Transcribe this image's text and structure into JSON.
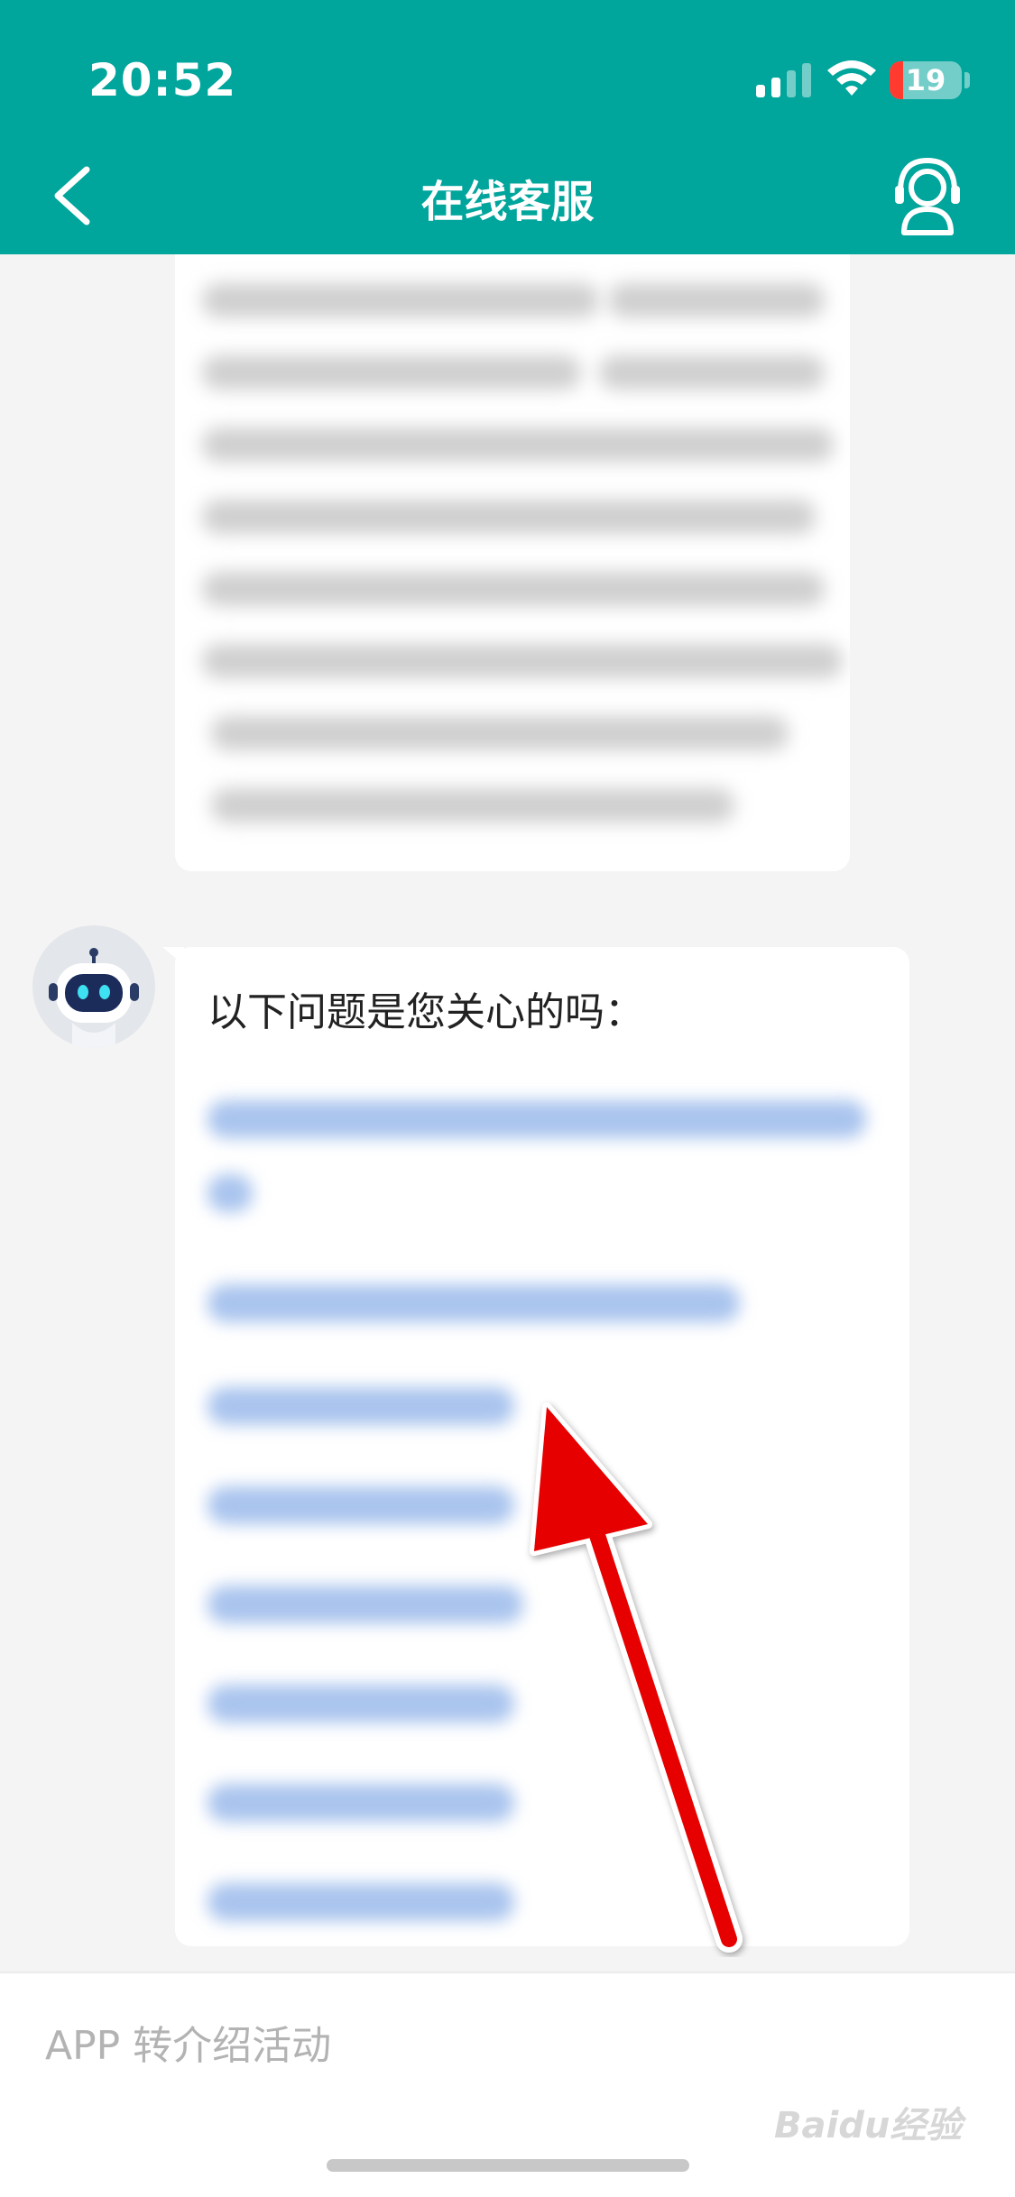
{
  "status_bar": {
    "time": "20:52",
    "battery_level": "19"
  },
  "header": {
    "title": "在线客服"
  },
  "messages": {
    "question_prompt": "以下问题是您关心的吗："
  },
  "input": {
    "placeholder": "APP 转介绍活动"
  },
  "watermark": {
    "text": "Baidu经验"
  },
  "colors": {
    "header": "#00a59c",
    "arrow": "#e60000",
    "link_blur": "#a9c4ee"
  }
}
